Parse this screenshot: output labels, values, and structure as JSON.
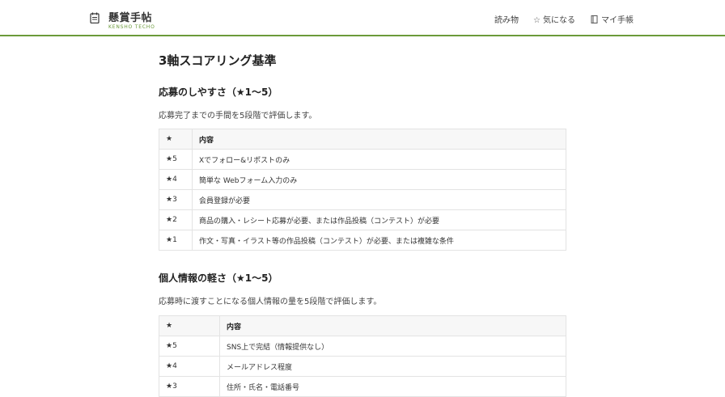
{
  "header": {
    "logo_title": "懸賞手帖",
    "logo_subtitle": "KENSHO TECHO",
    "nav": [
      {
        "label": "読み物",
        "icon": ""
      },
      {
        "label": "気になる",
        "icon": "star-outline-icon"
      },
      {
        "label": "マイ手帳",
        "icon": "notebook-icon"
      }
    ]
  },
  "page_heading": "3軸スコアリング基準",
  "sections": [
    {
      "title": "応募のしやすさ（★1〜5）",
      "description": "応募完了までの手間を5段階で評価します。",
      "table": {
        "headers": [
          "★",
          "内容"
        ],
        "rows": [
          [
            "★5",
            "Xでフォロー&リポストのみ"
          ],
          [
            "★4",
            "簡単な Webフォーム入力のみ"
          ],
          [
            "★3",
            "会員登録が必要"
          ],
          [
            "★2",
            "商品の購入・レシート応募が必要、または作品投稿（コンテスト）が必要"
          ],
          [
            "★1",
            "作文・写真・イラスト等の作品投稿（コンテスト）が必要、または複雑な条件"
          ]
        ]
      }
    },
    {
      "title": "個人情報の軽さ（★1〜5）",
      "description": "応募時に渡すことになる個人情報の量を5段階で評価します。",
      "table": {
        "headers": [
          "★",
          "内容"
        ],
        "rows": [
          [
            "★5",
            "SNS上で完結（情報提供なし）"
          ],
          [
            "★4",
            "メールアドレス程度"
          ],
          [
            "★3",
            "住所・氏名・電話番号"
          ]
        ]
      }
    }
  ],
  "colors": {
    "accent": "#6b9a3a"
  }
}
